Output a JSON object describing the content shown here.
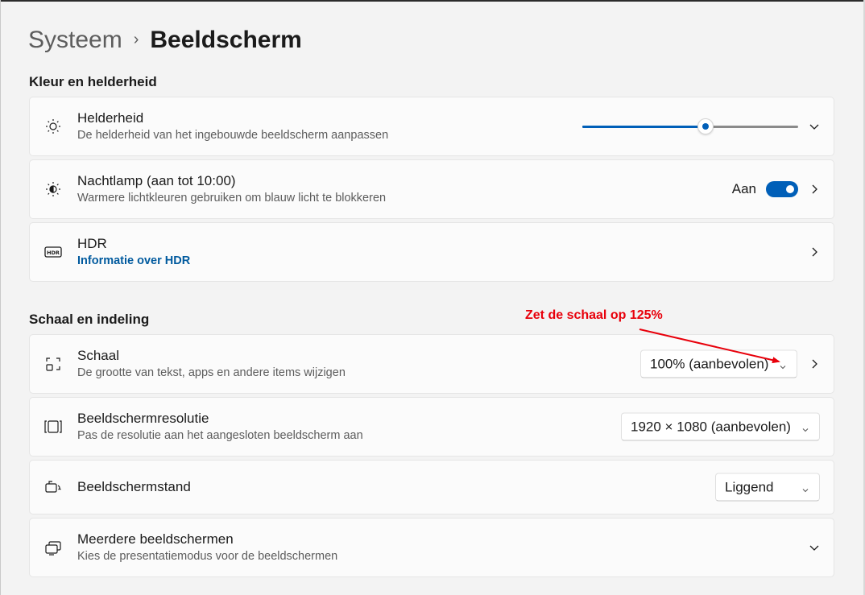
{
  "breadcrumb": {
    "parent": "Systeem",
    "separator": "›",
    "current": "Beeldscherm"
  },
  "sections": {
    "color": {
      "title": "Kleur en helderheid"
    },
    "scale": {
      "title": "Schaal en indeling"
    }
  },
  "brightness": {
    "title": "Helderheid",
    "subtitle": "De helderheid van het ingebouwde beeldscherm aanpassen",
    "level_percent": 57,
    "icon": "sun-icon"
  },
  "nightlight": {
    "title": "Nachtlamp (aan tot 10:00)",
    "subtitle": "Warmere lichtkleuren gebruiken om blauw licht te blokkeren",
    "toggle_label": "Aan",
    "toggle_on": true,
    "icon": "night-light-icon"
  },
  "hdr": {
    "title": "HDR",
    "link": "Informatie over HDR",
    "icon": "hdr-icon"
  },
  "scale": {
    "title": "Schaal",
    "subtitle": "De grootte van tekst, apps en andere items wijzigen",
    "value": "100% (aanbevolen)",
    "icon": "scale-icon"
  },
  "resolution": {
    "title": "Beeldschermresolutie",
    "subtitle": "Pas de resolutie aan het aangesloten beeldscherm aan",
    "value": "1920 × 1080 (aanbevolen)",
    "icon": "resolution-icon"
  },
  "orientation": {
    "title": "Beeldschermstand",
    "value": "Liggend",
    "icon": "orientation-icon"
  },
  "multiple": {
    "title": "Meerdere beeldschermen",
    "subtitle": "Kies de presentatiemodus voor de beeldschermen",
    "icon": "multiple-displays-icon"
  },
  "annotation": {
    "text": "Zet de schaal op 125%",
    "color": "#e8000b"
  },
  "colors": {
    "accent": "#005fb8",
    "link": "#005a9e"
  }
}
